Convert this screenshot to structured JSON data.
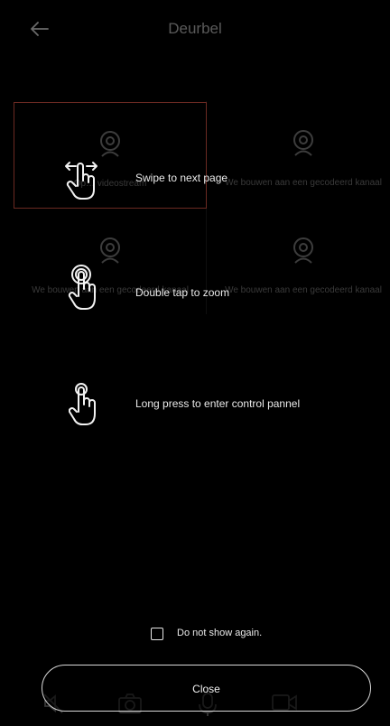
{
  "header": {
    "title": "Deurbel",
    "back_icon": "arrow-left-icon"
  },
  "tiles": [
    {
      "message": "Op…   videostream"
    },
    {
      "message": "We bouwen aan een gecodeerd kanaal"
    },
    {
      "message": "We bouwen aan een gecodeerd kanaal"
    },
    {
      "message": "We bouwen aan een gecodeerd kanaal"
    }
  ],
  "tips": [
    {
      "icon": "swipe-gesture-icon",
      "text": "Swipe to next page"
    },
    {
      "icon": "double-tap-gesture-icon",
      "text": "Double tap to zoom"
    },
    {
      "icon": "long-press-gesture-icon",
      "text": "Long press to enter control pannel"
    }
  ],
  "dont_show": {
    "label": "Do not show again.",
    "checked": false
  },
  "close": {
    "label": "Close"
  },
  "toolbar_icons": [
    "mute-icon",
    "camera-icon",
    "microphone-icon",
    "video-record-icon"
  ],
  "colors": {
    "background": "#000000",
    "selected_tile_border": "#6b2a22",
    "text": "#eaeaea"
  }
}
